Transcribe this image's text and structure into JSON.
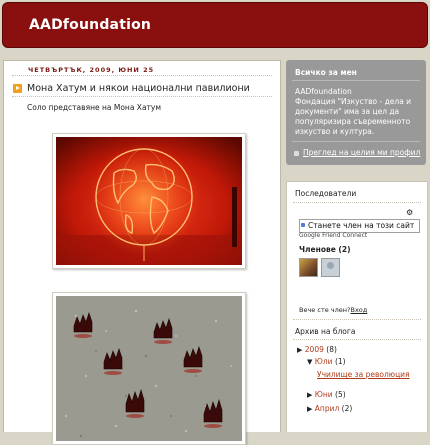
{
  "header": {
    "title": "AADfoundation"
  },
  "post": {
    "date": "ЧЕТВЪРТЪК, 2009, ЮНИ 25",
    "title": "Мона Хатум и някои национални павилиони",
    "intro": "Соло представяне на Мона Хатум"
  },
  "about": {
    "heading": "Всичко за мен",
    "name": "AADfoundation",
    "description": "Фондация \"Изкуство - дела и документи\" има за цел да популяризира съвременното изкуство и култура.",
    "profile_link": "Преглед на целия ми профил"
  },
  "followers": {
    "heading": "Последователи",
    "join_button": "Станете член на този сайт",
    "powered_by": "Google Friend Connect",
    "members_label": "Членове (2)",
    "already_member": "Вече сте член?",
    "login": "Вход"
  },
  "archive": {
    "heading": "Архив на блога",
    "year": "2009",
    "year_count": "(8)",
    "months": [
      {
        "name": "Юли",
        "count": "(1)",
        "expanded": true,
        "posts": [
          "Училище за революция"
        ]
      },
      {
        "name": "Юни",
        "count": "(5)",
        "expanded": false
      },
      {
        "name": "Април",
        "count": "(2)",
        "expanded": false
      }
    ]
  },
  "colors": {
    "header_bg": "#8a1010",
    "link": "#b03a1a",
    "sidebar_about_bg": "#999999",
    "page_bg": "#d9d6c7"
  }
}
